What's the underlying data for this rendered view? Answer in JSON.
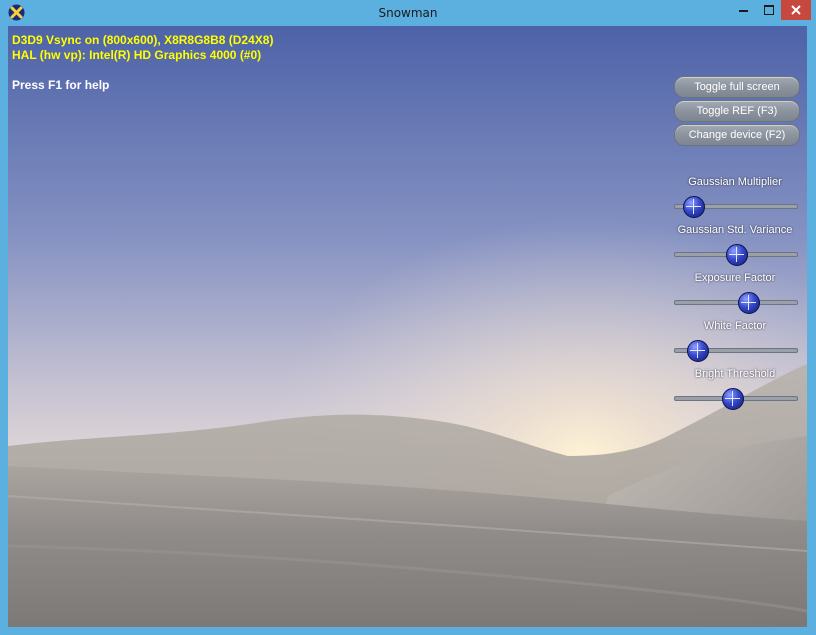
{
  "window": {
    "title": "Snowman"
  },
  "hud": {
    "device_stats": "D3D9 Vsync on (800x600), X8R8G8B8 (D24X8)",
    "device_info": "HAL (hw vp): Intel(R) HD Graphics 4000 (#0)",
    "help_hint": "Press F1 for help"
  },
  "buttons": {
    "toggle_fullscreen": "Toggle full screen",
    "toggle_ref": "Toggle REF (F3)",
    "change_device": "Change device (F2)"
  },
  "sliders": [
    {
      "label": "Gaussian Multiplier",
      "value": 0.15
    },
    {
      "label": "Gaussian Std. Variance",
      "value": 0.5
    },
    {
      "label": "Exposure Factor",
      "value": 0.6
    },
    {
      "label": "White Factor",
      "value": 0.18
    },
    {
      "label": "Bright Threshold",
      "value": 0.47
    }
  ],
  "colors": {
    "titlebar": "#5bb0e0",
    "close_button": "#c7483e",
    "stats_text": "#ffff00",
    "help_text": "#ffffff"
  }
}
